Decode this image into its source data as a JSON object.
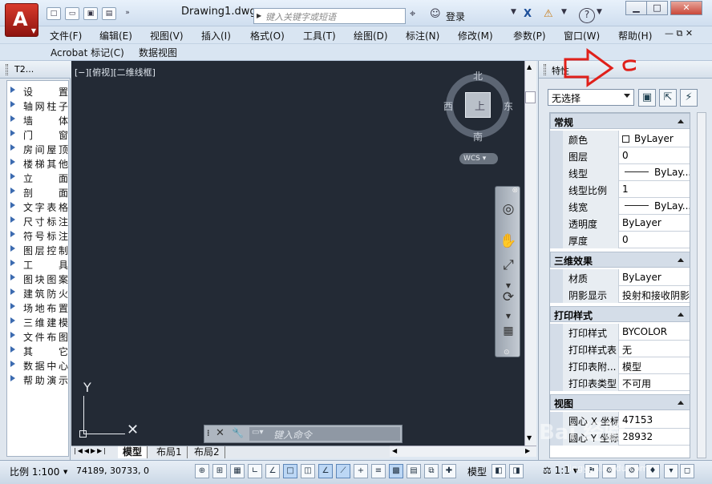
{
  "app": {
    "doc_title": "Drawing1.dwg",
    "search_placeholder": "键入关键字或短语",
    "login": "登录"
  },
  "menus": [
    "文件(F)",
    "编辑(E)",
    "视图(V)",
    "插入(I)",
    "格式(O)",
    "工具(T)",
    "绘图(D)",
    "标注(N)",
    "修改(M)",
    "参数(P)",
    "窗口(W)",
    "帮助(H)"
  ],
  "menus2": [
    "Acrobat 标记(C)",
    "数据视图"
  ],
  "left_palette": {
    "title": "T2...",
    "items": [
      "设  置",
      "轴网柱子",
      "墙  体",
      "门  窗",
      "房间屋顶",
      "楼梯其他",
      "立  面",
      "剖  面",
      "文字表格",
      "尺寸标注",
      "符号标注",
      "图层控制",
      "工  具",
      "图块图案",
      "建筑防火",
      "场地布置",
      "三维建模",
      "文件布图",
      "其  它",
      "数据中心",
      "帮助演示"
    ]
  },
  "drawing": {
    "view_label": "[−][俯视][二维线框]",
    "compass": {
      "n": "北",
      "s": "南",
      "e": "东",
      "w": "西",
      "top": "上"
    },
    "wcs": "WCS",
    "ucs_y": "Y",
    "cmd_placeholder": "键入命令",
    "tabs": [
      "模型",
      "布局1",
      "布局2"
    ]
  },
  "properties": {
    "title": "特性",
    "selection": "无选择",
    "sections": [
      {
        "name": "常规",
        "rows": [
          [
            "颜色",
            "ByLayer"
          ],
          [
            "图层",
            "0"
          ],
          [
            "线型",
            "ByLay..."
          ],
          [
            "线型比例",
            "1"
          ],
          [
            "线宽",
            "ByLay..."
          ],
          [
            "透明度",
            "ByLayer"
          ],
          [
            "厚度",
            "0"
          ]
        ]
      },
      {
        "name": "三维效果",
        "rows": [
          [
            "材质",
            "ByLayer"
          ],
          [
            "阴影显示",
            "投射和接收阴影"
          ]
        ]
      },
      {
        "name": "打印样式",
        "rows": [
          [
            "打印样式",
            "BYCOLOR"
          ],
          [
            "打印样式表",
            "无"
          ],
          [
            "打印表附...",
            "模型"
          ],
          [
            "打印表类型",
            "不可用"
          ]
        ]
      },
      {
        "name": "视图",
        "rows": [
          [
            "圆心 X 坐标",
            "47153"
          ],
          [
            "圆心 Y 坐标",
            "28932"
          ]
        ]
      }
    ]
  },
  "status": {
    "scale": "比例 1:100",
    "coords": "74189, 30733, 0",
    "model": "模型",
    "anno_scale": "1:1"
  },
  "watermark": {
    "main": "Bai 经验",
    "sub": "jingyan.baidu.com"
  },
  "colors": {
    "canvas": "#232a35",
    "accent_red": "#e0201a",
    "app_button": "#c4261c"
  }
}
